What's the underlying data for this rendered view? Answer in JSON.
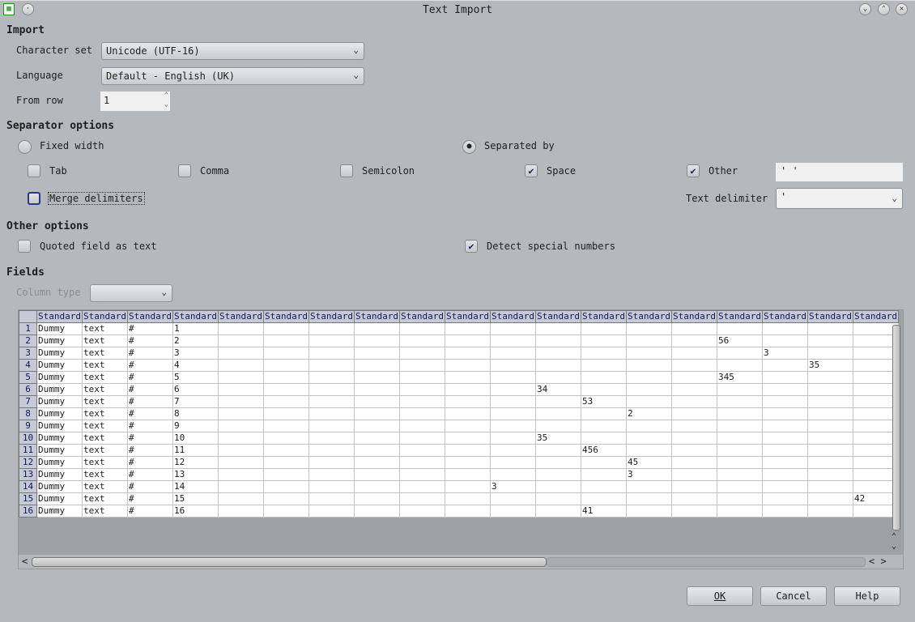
{
  "window": {
    "title": "Text Import"
  },
  "import": {
    "heading": "Import",
    "charset_label": "Character set",
    "charset_value": "Unicode (UTF-16)",
    "language_label": "Language",
    "language_value": "Default - English (UK)",
    "from_row_label": "From row",
    "from_row_value": "1"
  },
  "separator": {
    "heading": "Separator options",
    "fixed_width": "Fixed width",
    "fixed_width_selected": false,
    "separated_by": "Separated by",
    "separated_by_selected": true,
    "tab": "Tab",
    "tab_checked": false,
    "comma": "Comma",
    "comma_checked": false,
    "semicolon": "Semicolon",
    "semicolon_checked": false,
    "space": "Space",
    "space_checked": true,
    "other": "Other",
    "other_checked": true,
    "other_value": "'  '",
    "merge": "Merge delimiters",
    "merge_checked": false,
    "text_delimiter_label": "Text delimiter",
    "text_delimiter_value": "'"
  },
  "other_options": {
    "heading": "Other options",
    "quoted": "Quoted field as text",
    "quoted_checked": false,
    "detect": "Detect special numbers",
    "detect_checked": true
  },
  "fields": {
    "heading": "Fields",
    "column_type_label": "Column type",
    "column_type_value": "",
    "column_header": "Standard",
    "column_count": 19,
    "rows": [
      [
        "Dummy",
        "text",
        "#",
        "1"
      ],
      [
        "Dummy",
        "text",
        "#",
        "2",
        "",
        "",
        "",
        "",
        "",
        "",
        "",
        "",
        "",
        "",
        "",
        "56"
      ],
      [
        "Dummy",
        "text",
        "#",
        "3",
        "",
        "",
        "",
        "",
        "",
        "",
        "",
        "",
        "",
        "",
        "",
        "",
        "3"
      ],
      [
        "Dummy",
        "text",
        "#",
        "4",
        "",
        "",
        "",
        "",
        "",
        "",
        "",
        "",
        "",
        "",
        "",
        "",
        "",
        "35"
      ],
      [
        "Dummy",
        "text",
        "#",
        "5",
        "",
        "",
        "",
        "",
        "",
        "",
        "",
        "",
        "",
        "",
        "",
        "345"
      ],
      [
        "Dummy",
        "text",
        "#",
        "6",
        "",
        "",
        "",
        "",
        "",
        "",
        "",
        "34"
      ],
      [
        "Dummy",
        "text",
        "#",
        "7",
        "",
        "",
        "",
        "",
        "",
        "",
        "",
        "",
        "53"
      ],
      [
        "Dummy",
        "text",
        "#",
        "8",
        "",
        "",
        "",
        "",
        "",
        "",
        "",
        "",
        "",
        "2"
      ],
      [
        "Dummy",
        "text",
        "#",
        "9"
      ],
      [
        "Dummy",
        "text",
        "#",
        "10",
        "",
        "",
        "",
        "",
        "",
        "",
        "",
        "35"
      ],
      [
        "Dummy",
        "text",
        "#",
        "11",
        "",
        "",
        "",
        "",
        "",
        "",
        "",
        "",
        "456"
      ],
      [
        "Dummy",
        "text",
        "#",
        "12",
        "",
        "",
        "",
        "",
        "",
        "",
        "",
        "",
        "",
        "45"
      ],
      [
        "Dummy",
        "text",
        "#",
        "13",
        "",
        "",
        "",
        "",
        "",
        "",
        "",
        "",
        "",
        "3"
      ],
      [
        "Dummy",
        "text",
        "#",
        "14",
        "",
        "",
        "",
        "",
        "",
        "",
        "3"
      ],
      [
        "Dummy",
        "text",
        "#",
        "15",
        "",
        "",
        "",
        "",
        "",
        "",
        "",
        "",
        "",
        "",
        "",
        "",
        "",
        "",
        "42"
      ],
      [
        "Dummy",
        "text",
        "#",
        "16",
        "",
        "",
        "",
        "",
        "",
        "",
        "",
        "",
        "41"
      ]
    ]
  },
  "buttons": {
    "ok": "OK",
    "cancel": "Cancel",
    "help": "Help"
  }
}
